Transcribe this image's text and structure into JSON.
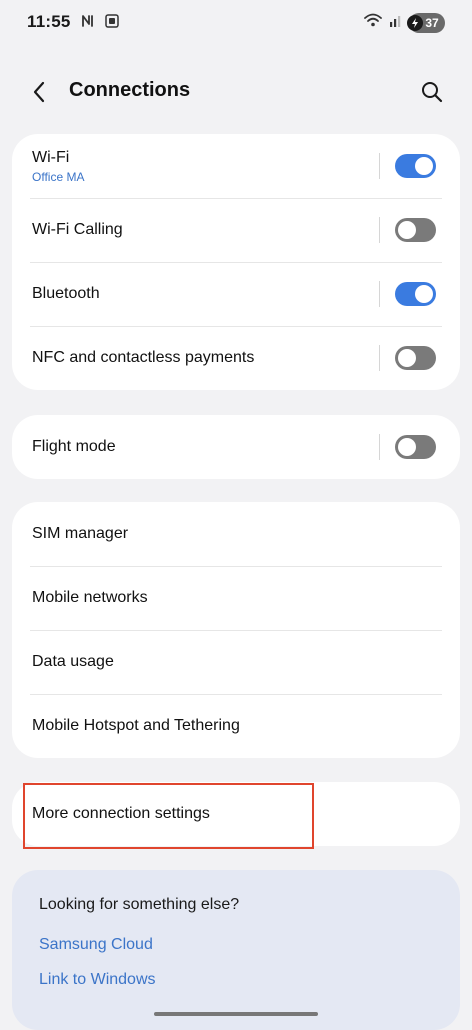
{
  "status_bar": {
    "time": "11:55",
    "battery": "37"
  },
  "header": {
    "title": "Connections"
  },
  "groups": {
    "connectivity": [
      {
        "label": "Wi-Fi",
        "sub": "Office MA",
        "toggle": "on"
      },
      {
        "label": "Wi-Fi Calling",
        "toggle": "off"
      },
      {
        "label": "Bluetooth",
        "toggle": "on"
      },
      {
        "label": "NFC and contactless payments",
        "toggle": "off"
      }
    ],
    "flight": [
      {
        "label": "Flight mode",
        "toggle": "off"
      }
    ],
    "network": [
      {
        "label": "SIM manager"
      },
      {
        "label": "Mobile networks"
      },
      {
        "label": "Data usage"
      },
      {
        "label": "Mobile Hotspot and Tethering"
      }
    ],
    "more": [
      {
        "label": "More connection settings"
      }
    ]
  },
  "suggestions": {
    "title": "Looking for something else?",
    "links": [
      "Samsung Cloud",
      "Link to Windows"
    ]
  },
  "colors": {
    "accent": "#3a7be0",
    "link": "#3b74c8",
    "highlight": "#e0452d",
    "background": "#f2f2f4"
  }
}
